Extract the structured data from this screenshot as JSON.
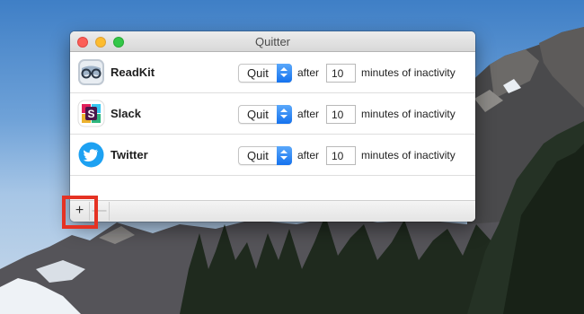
{
  "window": {
    "title": "Quitter"
  },
  "apps": [
    {
      "name": "ReadKit",
      "icon": "readkit-glasses-icon",
      "action": "Quit",
      "after_label": "after",
      "minutes": "10",
      "suffix": "minutes of inactivity"
    },
    {
      "name": "Slack",
      "icon": "slack-logo-icon",
      "action": "Quit",
      "after_label": "after",
      "minutes": "10",
      "suffix": "minutes of inactivity"
    },
    {
      "name": "Twitter",
      "icon": "twitter-bird-icon",
      "action": "Quit",
      "after_label": "after",
      "minutes": "10",
      "suffix": "minutes of inactivity"
    }
  ],
  "toolbar": {
    "add_label": "+",
    "remove_label": "—"
  },
  "colors": {
    "highlight": "#e53223",
    "stepper_blue": "#1572ee"
  }
}
